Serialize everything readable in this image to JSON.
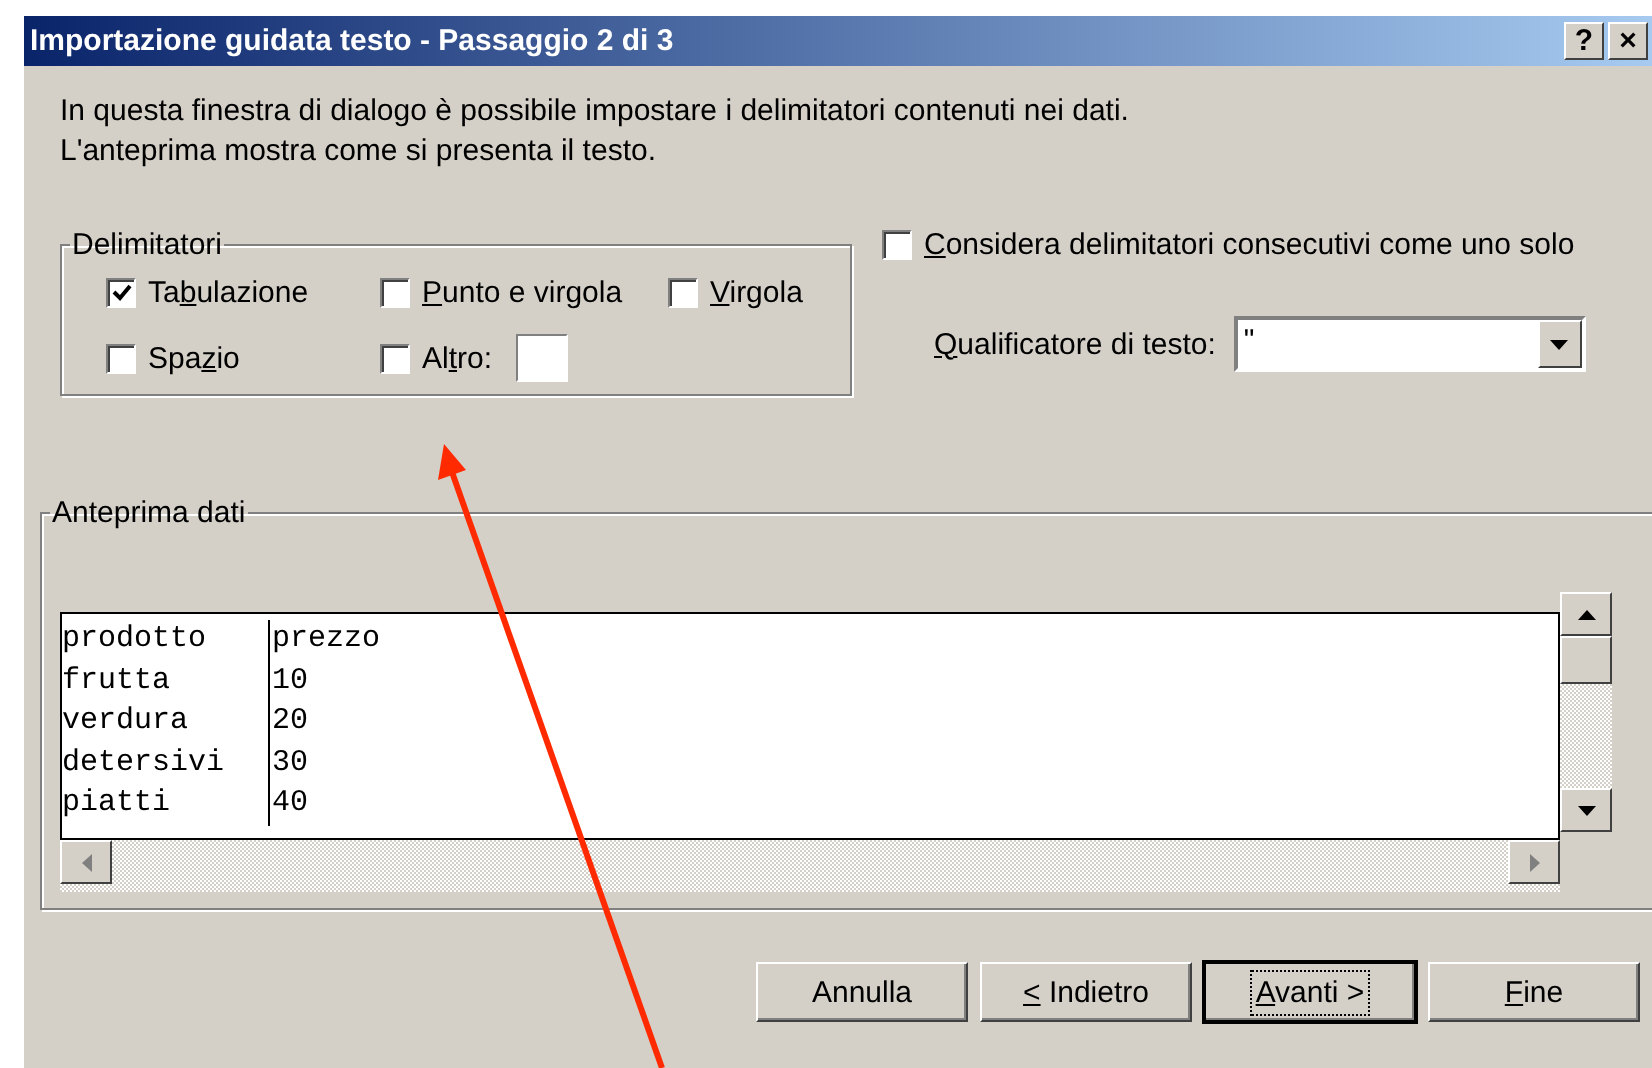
{
  "window": {
    "title": "Importazione guidata testo - Passaggio 2 di 3",
    "title_buttons": [
      "?",
      "×"
    ]
  },
  "description": [
    "In questa finestra di dialogo è possibile impostare i delimitatori contenuti nei dati.",
    "L'anteprima mostra come si presenta il testo."
  ],
  "delimiters": {
    "legend": "Delimitatori",
    "items": [
      {
        "kind": "checkbox",
        "label": {
          "pre": "Ta",
          "key": "b",
          "post": "ulazione"
        },
        "checked": true
      },
      {
        "kind": "checkbox",
        "label": {
          "key": "P",
          "post": "unto e virgola"
        },
        "checked": false
      },
      {
        "kind": "checkbox",
        "label": {
          "key": "V",
          "post": "irgola"
        },
        "checked": false
      },
      {
        "kind": "checkbox",
        "label": {
          "pre": "Spa",
          "key": "z",
          "post": "io"
        },
        "checked": false
      },
      {
        "kind": "with_field",
        "label": {
          "pre": "Al",
          "key": "t",
          "post": "ro:"
        },
        "checked": false
      }
    ]
  },
  "consecutive": {
    "label": {
      "key": "C",
      "post": "onsidera delimitatori consecutivi come uno solo"
    },
    "checked": false
  },
  "qualifier": {
    "label": {
      "key": "Q",
      "post": "ualificatore di testo:"
    },
    "value": "\""
  },
  "preview": {
    "legend": "Anteprima dati",
    "rows": [
      [
        "prodotto",
        "prezzo"
      ],
      [
        "frutta",
        "10"
      ],
      [
        "verdura",
        "20"
      ],
      [
        "detersivi",
        "30"
      ],
      [
        "piatti",
        "40"
      ]
    ]
  },
  "buttons": [
    {
      "label": {
        "pre": "Annulla"
      },
      "focused": false
    },
    {
      "label": {
        "key": "<",
        "post": " Indietro"
      },
      "focused": false
    },
    {
      "label": {
        "key": "A",
        "post": "vanti >"
      },
      "focused": true
    },
    {
      "label": {
        "key": "F",
        "post": "ine"
      },
      "focused": false
    }
  ],
  "annotation": {
    "kind": "arrow",
    "color": "#ff2a00"
  }
}
